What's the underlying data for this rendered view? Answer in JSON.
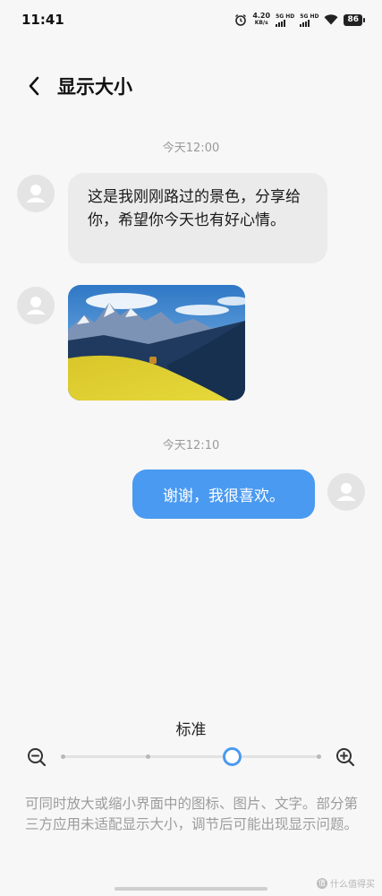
{
  "status_bar": {
    "time": "11:41",
    "net_speed_value": "4.20",
    "net_speed_unit": "KB/s",
    "sim1_label": "5G HD",
    "sim2_label": "5G HD",
    "battery": "86"
  },
  "header": {
    "back_icon": "chevron-left-icon",
    "title": "显示大小"
  },
  "chat": {
    "timestamp_1": "今天12:00",
    "incoming_text": "这是我刚刚路过的景色，分享给你，希望你今天也有好心情。",
    "timestamp_2": "今天12:10",
    "outgoing_text": "谢谢，我很喜欢。"
  },
  "size_control": {
    "current_label": "标准",
    "level_index": 2,
    "level_count": 4,
    "zoom_out_icon": "zoom-out-icon",
    "zoom_in_icon": "zoom-in-icon"
  },
  "note": "可同时放大或缩小界面中的图标、图片、文字。部分第三方应用未适配显示大小，调节后可能出现显示问题。",
  "watermark": "什么值得买",
  "colors": {
    "accent": "#4a9af1",
    "background": "#f7f7f7",
    "incoming_bubble": "#ebebeb",
    "secondary_text": "#9c9c9c"
  }
}
